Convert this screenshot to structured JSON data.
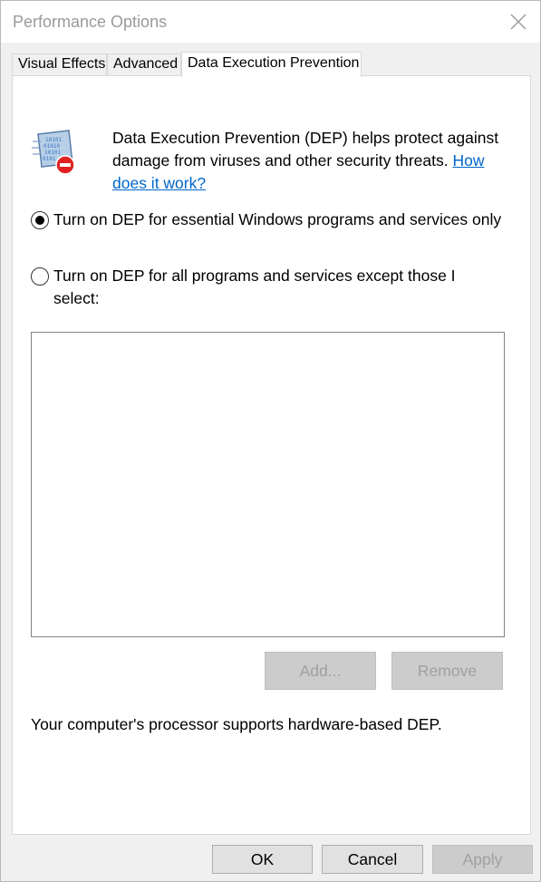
{
  "window": {
    "title": "Performance Options"
  },
  "tabs": [
    {
      "label": "Visual Effects"
    },
    {
      "label": "Advanced"
    },
    {
      "label": "Data Execution Prevention"
    }
  ],
  "dep": {
    "description": "Data Execution Prevention (DEP) helps protect against damage from viruses and other security threats.",
    "link_text": "How does it work?",
    "options": [
      {
        "label": "Turn on DEP for essential Windows programs and services only",
        "selected": true
      },
      {
        "label": "Turn on DEP for all programs and services except those I select:",
        "selected": false
      }
    ],
    "add_label": "Add...",
    "remove_label": "Remove",
    "status": "Your computer's processor supports hardware-based DEP."
  },
  "footer": {
    "ok_label": "OK",
    "cancel_label": "Cancel",
    "apply_label": "Apply"
  },
  "icons": {
    "close": "close-icon",
    "dep": "dep-shield-icon"
  },
  "colors": {
    "link": "#0066cc",
    "disabled_text": "#a0a0a0"
  }
}
